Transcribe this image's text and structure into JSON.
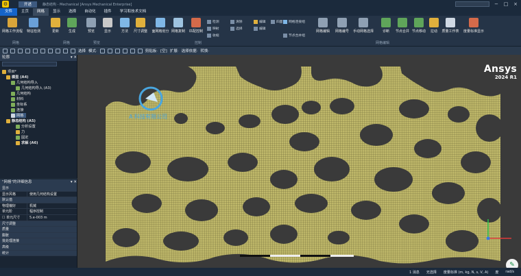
{
  "title": {
    "tab": "开述",
    "text": "静态结构 - Mechanical [Ansys Mechanical Enterprise]"
  },
  "menu": [
    "文件",
    "主页",
    "网格",
    "显示",
    "选择",
    "自动化",
    "插件",
    "学习和技术文档"
  ],
  "menu_active": "网格",
  "ribbon": {
    "buttons": [
      "网格工作流程",
      "特征检测",
      "更新",
      "生成",
      "预览",
      "显示",
      "方法",
      "尺寸调整",
      "面网格划分",
      "网格复制",
      "匹配控制",
      "网格连接组",
      "网格编辑",
      "网格编号",
      "手动网格选择",
      "诊断",
      "节点合并",
      "节点移动",
      "拉动",
      "质量工作表",
      "度量标准显示"
    ],
    "small": [
      "检测",
      "映射",
      "收缩",
      "清除",
      "选择",
      "编辑",
      "节点合并组",
      "网格连接组",
      "四面"
    ],
    "groups": [
      "网格",
      "控制",
      "网格编辑",
      "预览"
    ]
  },
  "toolbar": {
    "items": [
      "选择",
      "模式·",
      "剪贴板·",
      "[空]",
      "扩展·",
      "选择依据·",
      "转换·"
    ]
  },
  "outline": {
    "header": "轮廓",
    "items": [
      {
        "label": "项目*",
        "level": 0,
        "color": "#e0b03c"
      },
      {
        "label": "模型 (A4)",
        "level": 1,
        "color": "#e0b03c"
      },
      {
        "label": "几何结构导入",
        "level": 2,
        "color": "#7fae5a"
      },
      {
        "label": "几何结构导入 (A3)",
        "level": 3,
        "color": "#7fae5a"
      },
      {
        "label": "几何结构",
        "level": 2,
        "color": "#7fae5a"
      },
      {
        "label": "材料",
        "level": 2,
        "color": "#7fae5a"
      },
      {
        "label": "坐标系",
        "level": 2,
        "color": "#7fae5a"
      },
      {
        "label": "连接",
        "level": 2,
        "color": "#7fae5a"
      },
      {
        "label": "网格",
        "level": 2,
        "color": "#cfd8e3"
      },
      {
        "label": "静态结构 (A5)",
        "level": 1,
        "color": "#e0b03c"
      },
      {
        "label": "分析设置",
        "level": 2,
        "color": "#7fae5a"
      },
      {
        "label": "力",
        "level": 2,
        "color": "#e0b03c"
      },
      {
        "label": "固定",
        "level": 2,
        "color": "#7fae5a"
      },
      {
        "label": "求解 (A6)",
        "level": 2,
        "color": "#e0b03c"
      }
    ]
  },
  "details": {
    "header": "\"网格\"的详细信息",
    "rows": [
      {
        "section": true,
        "k": "显示"
      },
      {
        "k": "显示风格",
        "v": "使用几何结构设置"
      },
      {
        "section": true,
        "k": "默认值"
      },
      {
        "k": "物理偏好",
        "v": "机械"
      },
      {
        "k": "单元阶",
        "v": "程序控制"
      },
      {
        "k": "☐ 单元尺寸",
        "v": "5.e-003 m"
      },
      {
        "section": true,
        "k": "尺寸调整"
      },
      {
        "section": true,
        "k": "质量"
      },
      {
        "section": true,
        "k": "膨胀"
      },
      {
        "section": true,
        "k": "批处理连接"
      },
      {
        "section": true,
        "k": "高级"
      },
      {
        "section": true,
        "k": "统计"
      }
    ]
  },
  "viewport": {
    "logo": "Ansys",
    "version": "2024 R1",
    "watermark": "A 科技有限公司"
  },
  "status": {
    "messages": "1 消息",
    "selection": "无选择",
    "units": "度量标准 (m, kg, N, s, V, A)",
    "angle": "度",
    "rad": "rad/s"
  },
  "colors": {
    "accent": "#1664c9",
    "mesh": "#bfb86a",
    "void": "#3a3a3a"
  }
}
